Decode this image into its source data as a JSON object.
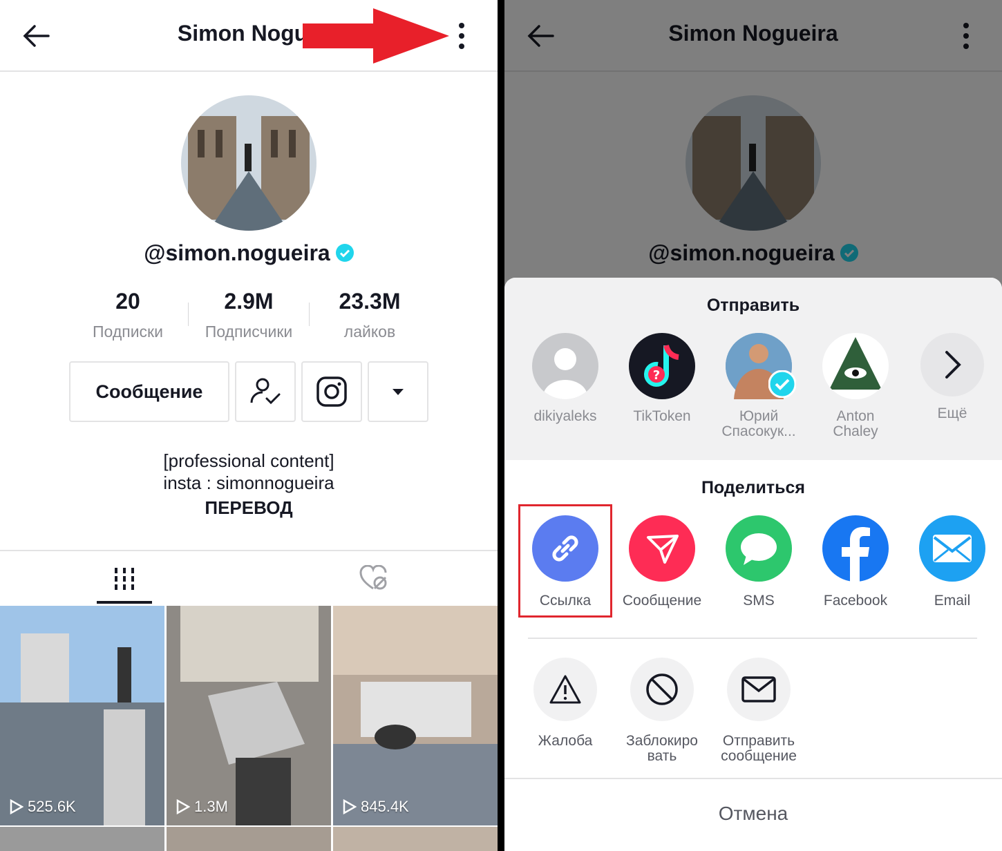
{
  "left": {
    "title": "Simon Nogue",
    "handle": "@simon.nogueira",
    "stats": [
      {
        "value": "20",
        "label": "Подписки"
      },
      {
        "value": "2.9M",
        "label": "Подписчики"
      },
      {
        "value": "23.3M",
        "label": "лайков"
      }
    ],
    "message_button": "Сообщение",
    "bio": [
      "[professional content]",
      "insta : simonnogueira"
    ],
    "translate": "ПЕРЕВОД",
    "videos": [
      {
        "views": "525.6K"
      },
      {
        "views": "1.3M"
      },
      {
        "views": "845.4K"
      }
    ]
  },
  "right": {
    "title": "Simon Nogueira",
    "handle": "@simon.nogueira",
    "send_title": "Отправить",
    "contacts": [
      {
        "name": "dikiyaleks"
      },
      {
        "name": "TikToken"
      },
      {
        "name_line1": "Юрий",
        "name_line2": "Спасокук..."
      },
      {
        "name_line1": "Anton",
        "name_line2": "Chaley"
      },
      {
        "name": "Ещё"
      }
    ],
    "share_title": "Поделиться",
    "share": [
      {
        "label": "Ссылка",
        "color": "#5b7cf0"
      },
      {
        "label": "Сообщение",
        "color": "#fe2c55"
      },
      {
        "label": "SMS",
        "color": "#2dc76d"
      },
      {
        "label": "Facebook",
        "color": "#1877f2"
      },
      {
        "label": "Email",
        "color": "#1da1f2"
      }
    ],
    "actions": [
      {
        "label": "Жалоба"
      },
      {
        "label_line1": "Заблокиро",
        "label_line2": "вать"
      },
      {
        "label_line1": "Отправить",
        "label_line2": "сообщение"
      }
    ],
    "cancel": "Отмена"
  },
  "colors": {
    "highlight": "#e0262e",
    "arrow": "#e8202a",
    "verified": "#20d5ec"
  }
}
